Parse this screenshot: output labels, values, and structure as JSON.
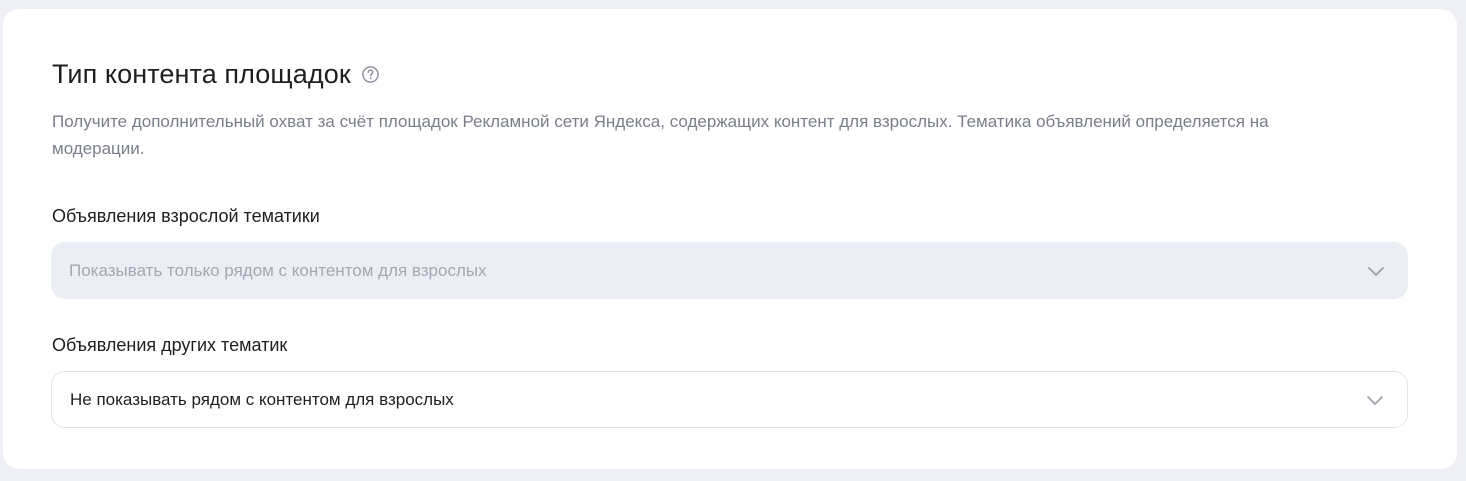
{
  "section": {
    "title": "Тип контента площадок",
    "help_icon": "question-circle-icon",
    "description": "Получите дополнительный охват за счёт площадок Рекламной сети Яндекса, содержащих контент для взрослых. Тематика объявлений определяется на модерации."
  },
  "fields": {
    "adult_ads": {
      "label": "Объявления взрослой тематики",
      "value": "Показывать только рядом с контентом для взрослых",
      "disabled": true,
      "icon": "chevron-down-icon"
    },
    "other_ads": {
      "label": "Объявления других тематик",
      "value": "Не показывать рядом с контентом для взрослых",
      "disabled": false,
      "icon": "chevron-down-icon"
    }
  },
  "colors": {
    "page_background": "#eef0f6",
    "card_background": "#ffffff",
    "disabled_select_background": "#eceef6",
    "muted_text": "#7a7e89",
    "primary_text": "#1f1f22"
  }
}
